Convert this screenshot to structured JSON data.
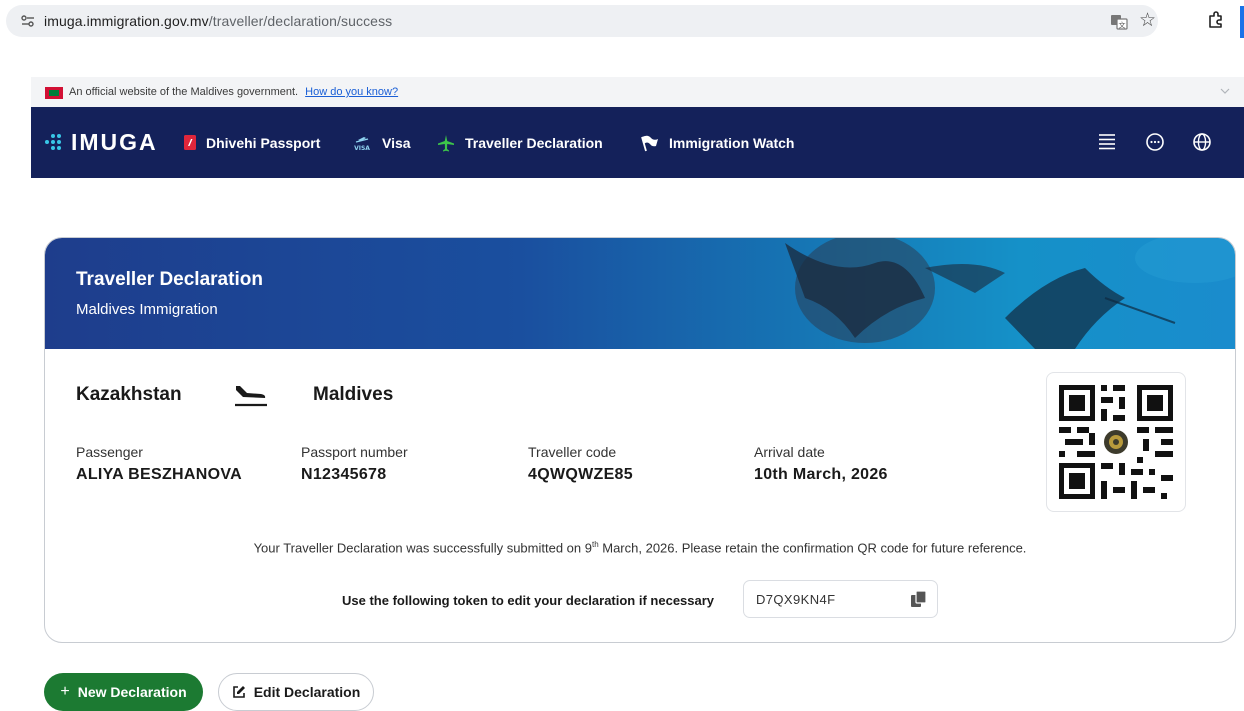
{
  "browser": {
    "url_host": "imuga.immigration.gov.mv",
    "url_path": "/traveller/declaration/success"
  },
  "gov_banner": {
    "text": "An official website of the Maldives government.",
    "link": "How do you know?"
  },
  "nav": {
    "logo": "IMUGA",
    "items": [
      {
        "label": "Dhivehi Passport",
        "icon": "passport-icon"
      },
      {
        "label": "Visa",
        "icon": "visa-icon"
      },
      {
        "label": "Traveller Declaration",
        "icon": "airplane-icon"
      },
      {
        "label": "Immigration Watch",
        "icon": "flag-icon"
      }
    ],
    "right_icons": [
      "menu-icon",
      "chat-icon",
      "globe-icon"
    ]
  },
  "card": {
    "title": "Traveller Declaration",
    "subtitle": "Maldives Immigration",
    "origin": "Kazakhstan",
    "destination": "Maldives",
    "fields": [
      {
        "label": "Passenger",
        "value": "ALIYA BESZHANOVA"
      },
      {
        "label": "Passport number",
        "value": "N12345678"
      },
      {
        "label": "Traveller code",
        "value": "4QWQWZE85"
      },
      {
        "label": "Arrival date",
        "value": "10th March, 2026"
      }
    ],
    "success_prefix": "Your Traveller Declaration was successfully submitted on 9",
    "success_sup": "th",
    "success_suffix": " March, 2026. Please retain the confirmation QR code for future reference.",
    "token_label": "Use the following token to edit your declaration if necessary",
    "token_value": "D7QX9KN4F"
  },
  "actions": {
    "new_label": "New Declaration",
    "edit_label": "Edit Declaration"
  },
  "colors": {
    "nav_bg": "#14215a",
    "accent_green": "#1c7a32",
    "logo_dots": "#38c7e6"
  }
}
